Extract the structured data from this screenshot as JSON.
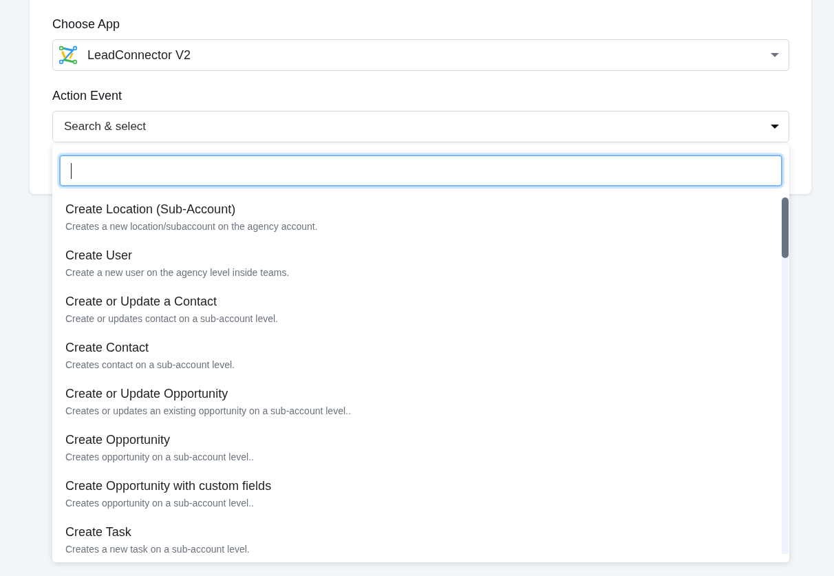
{
  "form": {
    "fields": [
      {
        "kind": "app_select",
        "label": "Choose App",
        "value": "LeadConnector V2",
        "expanded": false
      },
      {
        "kind": "search_select",
        "label": "Action Event",
        "placeholder": "Search & select",
        "expanded": true,
        "dropdown": {
          "search": {
            "focused": true
          },
          "options": [
            {
              "title": "Create Location (Sub-Account)",
              "description": "Creates a new location/subaccount on the agency account.",
              "selected": false
            },
            {
              "title": "Create User",
              "description": "Create a new user on the agency level inside teams.",
              "selected": false
            },
            {
              "title": "Create or Update a Contact",
              "description": "Create or updates contact on a sub-account level.",
              "selected": false
            },
            {
              "title": "Create Contact",
              "description": "Creates contact on a sub-account level.",
              "selected": false
            },
            {
              "title": "Create or Update Opportunity",
              "description": "Creates or updates an existing opportunity on a sub-account level..",
              "selected": false
            },
            {
              "title": "Create Opportunity",
              "description": "Creates opportunity on a sub-account level..",
              "selected": false
            },
            {
              "title": "Create Opportunity with custom fields",
              "description": "Creates opportunity on a sub-account level..",
              "selected": false
            },
            {
              "title": "Create Task",
              "description": "Creates a new task on a sub-account level.",
              "selected": false
            }
          ]
        }
      }
    ]
  }
}
